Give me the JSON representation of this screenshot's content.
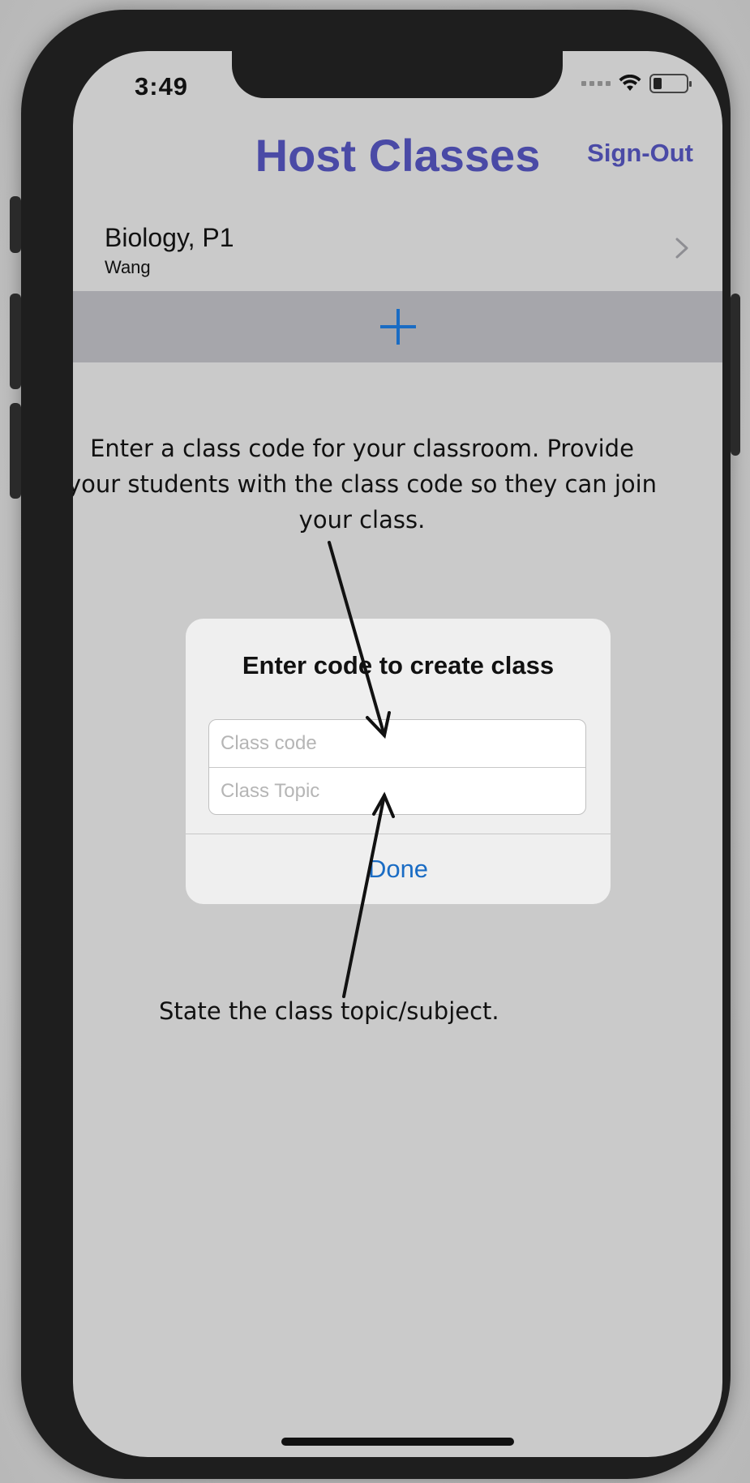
{
  "status": {
    "time": "3:49"
  },
  "header": {
    "title": "Host Classes",
    "signout_label": "Sign-Out"
  },
  "class_list": [
    {
      "title": "Biology, P1",
      "teacher": "Wang"
    }
  ],
  "add_bar": {
    "icon": "plus-icon"
  },
  "annotations": {
    "top": "Enter a class code for your classroom. Provide your students with the class code so they can join your class.",
    "bottom": "State the class topic/subject."
  },
  "dialog": {
    "title": "Enter code to create class",
    "class_code_placeholder": "Class code",
    "class_code_value": "",
    "class_topic_placeholder": "Class Topic",
    "class_topic_value": "",
    "done_label": "Done"
  },
  "colors": {
    "brand": "#4a4aa6",
    "link": "#1a6cc4",
    "screen_bg": "#cacaca",
    "add_bar_bg": "#a6a6ab"
  }
}
